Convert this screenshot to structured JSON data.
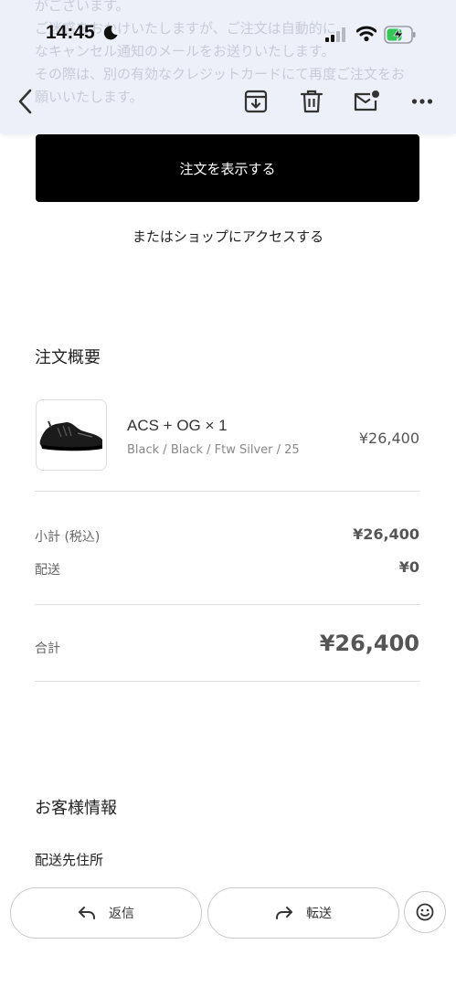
{
  "status_bar": {
    "time": "14:45"
  },
  "email_background_text": [
    "がございます。",
    "ご迷惑をおかけいたしますが、ご注文は自動的に",
    "なキャンセル通知のメールをお送りいたします。",
    "その際は、別の有効なクレジットカードにて再度ご注文をお",
    "願いいたします。"
  ],
  "toolbar": {
    "icons": [
      "back-icon",
      "archive-icon",
      "trash-icon",
      "mark-unread-icon",
      "more-icon"
    ]
  },
  "actions": {
    "view_order": "注文を表示する",
    "shop_link": "またはショップにアクセスする"
  },
  "order_summary": {
    "title": "注文概要",
    "item": {
      "name": "ACS + OG × 1",
      "variant": "Black / Black / Ftw Silver / 25",
      "price": "¥26,400"
    },
    "subtotal_label": "小計 (税込)",
    "subtotal_value": "¥26,400",
    "shipping_label": "配送",
    "shipping_value": "¥0",
    "total_label": "合計",
    "total_value": "¥26,400"
  },
  "customer_info": {
    "title": "お客様情報",
    "shipping_address_label": "配送先住所"
  },
  "bottom_bar": {
    "reply_label": "返信",
    "forward_label": "転送"
  },
  "colors": {
    "header_bg": "#edf0f8",
    "button_bg": "#000000",
    "battery_green": "#35c759"
  }
}
